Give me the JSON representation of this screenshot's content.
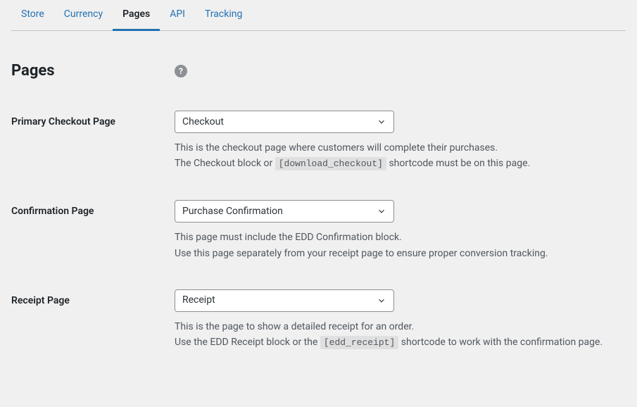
{
  "tabs": {
    "items": [
      {
        "label": "Store",
        "active": false
      },
      {
        "label": "Currency",
        "active": false
      },
      {
        "label": "Pages",
        "active": true
      },
      {
        "label": "API",
        "active": false
      },
      {
        "label": "Tracking",
        "active": false
      }
    ]
  },
  "heading": "Pages",
  "help_icon_char": "?",
  "fields": {
    "checkout": {
      "label": "Primary Checkout Page",
      "selected": "Checkout",
      "desc_line1": "This is the checkout page where customers will complete their purchases.",
      "desc_line2_before": "The Checkout block or ",
      "desc_line2_code": "[download_checkout]",
      "desc_line2_after": " shortcode must be on this page."
    },
    "confirmation": {
      "label": "Confirmation Page",
      "selected": "Purchase Confirmation",
      "desc_line1": "This page must include the EDD Confirmation block.",
      "desc_line2": "Use this page separately from your receipt page to ensure proper conversion tracking."
    },
    "receipt": {
      "label": "Receipt Page",
      "selected": "Receipt",
      "desc_line1": "This is the page to show a detailed receipt for an order.",
      "desc_line2_before": "Use the EDD Receipt block or the ",
      "desc_line2_code": "[edd_receipt]",
      "desc_line2_after": " shortcode to work with the confirmation page."
    }
  }
}
